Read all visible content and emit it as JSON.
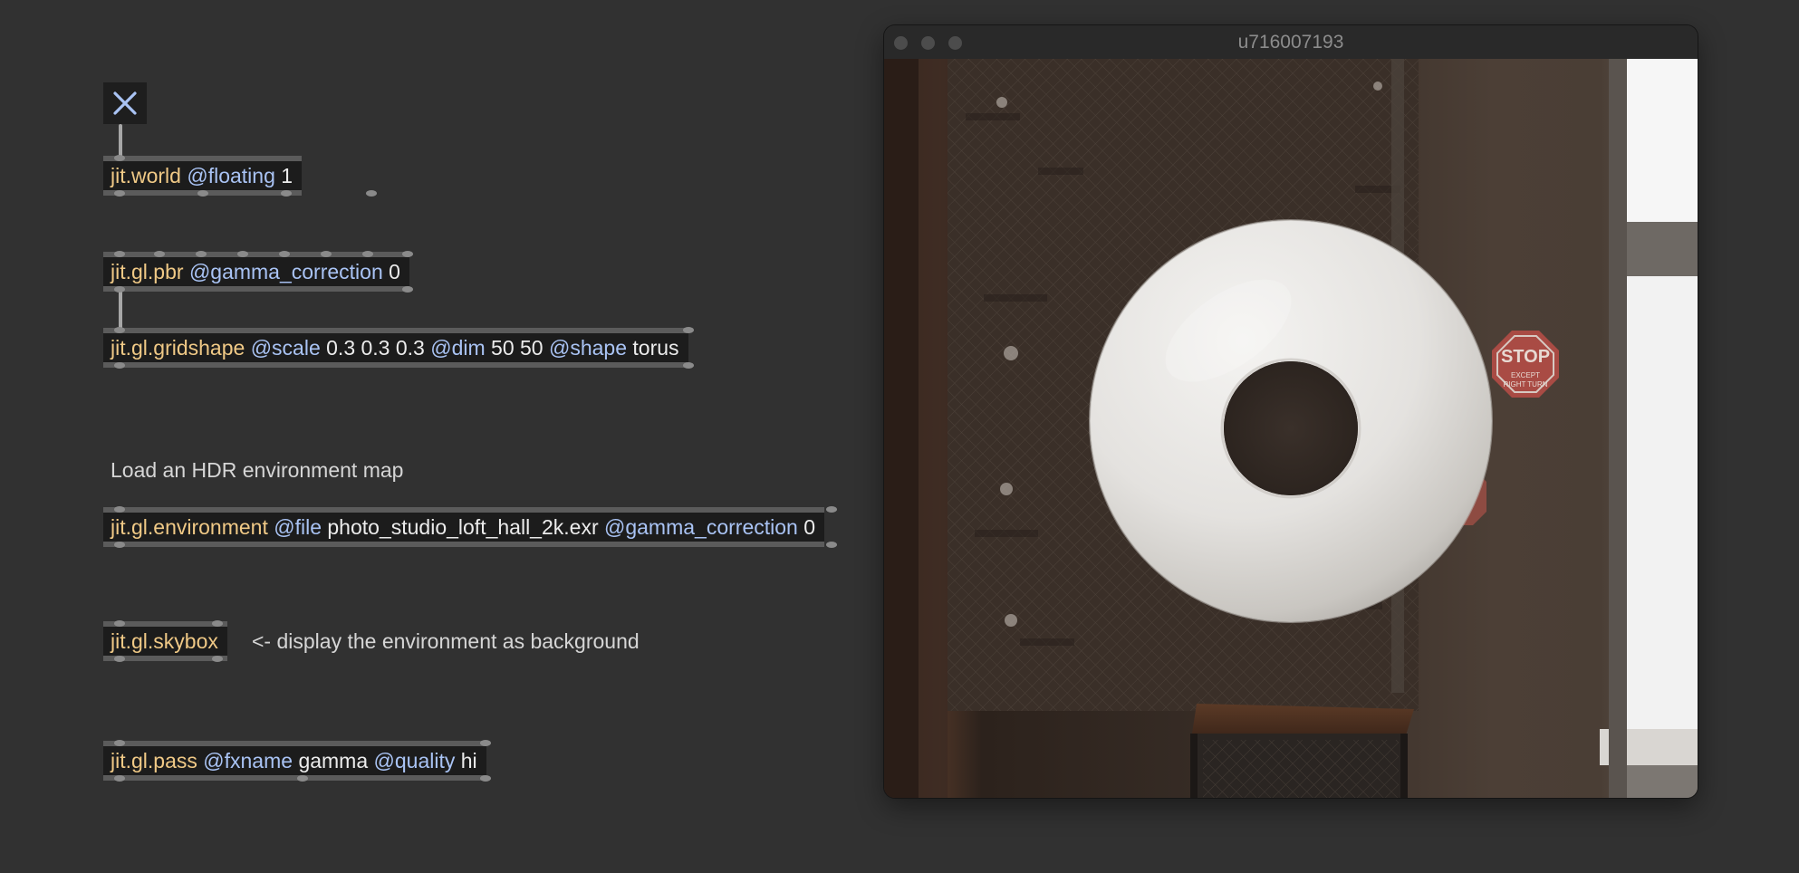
{
  "patch": {
    "toggle": {
      "icon": "close-x-icon",
      "state": "on"
    },
    "objects": {
      "world": {
        "class": "jit.world",
        "a1": "@floating",
        "v1": "1"
      },
      "pbr": {
        "class": "jit.gl.pbr",
        "a1": "@gamma_correction",
        "v1": "0"
      },
      "gridshape": {
        "class": "jit.gl.gridshape",
        "a1": "@scale",
        "v1": "0.3 0.3 0.3",
        "a2": "@dim",
        "v2": "50 50",
        "a3": "@shape",
        "v3": "torus"
      },
      "environment": {
        "class": "jit.gl.environment",
        "a1": "@file",
        "v1": "photo_studio_loft_hall_2k.exr",
        "a2": "@gamma_correction",
        "v2": "0"
      },
      "skybox": {
        "class": "jit.gl.skybox"
      },
      "pass": {
        "class": "jit.gl.pass",
        "a1": "@fxname",
        "v1": "gamma",
        "a2": "@quality",
        "v2": "hi"
      }
    },
    "comments": {
      "hdr": "Load an HDR environment map",
      "skybox": "<- display the environment as background"
    }
  },
  "window": {
    "title": "u716007193",
    "scene": {
      "object": "torus",
      "environment": "photo studio loft hall",
      "stop_sign_text": "STOP",
      "stop_sign_subtext": "EXCEPT\nRIGHT TURN"
    }
  },
  "colors": {
    "background": "#313131",
    "object_box": "#1c1c1c",
    "object_class": "#f0c986",
    "attribute": "#a9c3f4",
    "value": "#ececec"
  }
}
